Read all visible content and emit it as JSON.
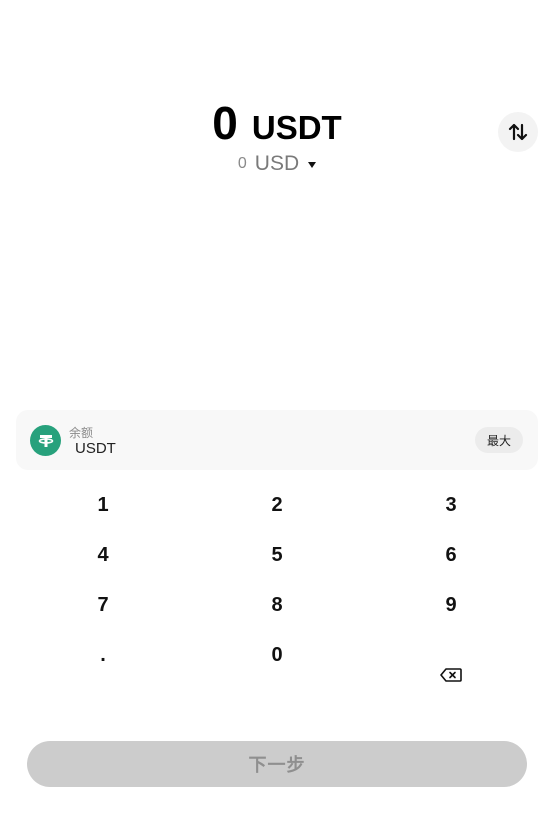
{
  "amount": {
    "value": "0",
    "unit": "USDT"
  },
  "fiat": {
    "value": "0",
    "currency": "USD"
  },
  "icons": {
    "swap": "swap-vertical-icon",
    "token": "tether-logo-icon",
    "dropdown": "caret-down-icon",
    "backspace": "backspace-icon"
  },
  "balance": {
    "label": "余额",
    "value": "USDT",
    "max_label": "最大"
  },
  "keypad": {
    "keys": [
      "1",
      "2",
      "3",
      "4",
      "5",
      "6",
      "7",
      "8",
      "9",
      ".",
      "0"
    ]
  },
  "next_button": {
    "label": "下一步"
  },
  "colors": {
    "tether_green": "#27a17c",
    "disabled_button_bg": "#cccccc",
    "disabled_button_text": "#8f8f8f",
    "card_bg": "#f8f8f8"
  }
}
